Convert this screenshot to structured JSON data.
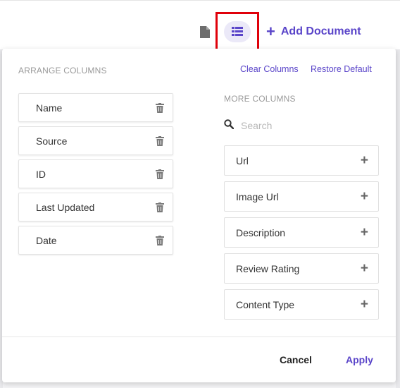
{
  "toolbar": {
    "add_document_label": "Add Document",
    "document_icon": "document-icon",
    "list_view_icon": "list-view-icon",
    "accent_color": "#5a45c9",
    "highlight_color": "#e0000a"
  },
  "arrange": {
    "title": "ARRANGE COLUMNS",
    "clear_label": "Clear Columns",
    "restore_label": "Restore Default",
    "columns": [
      {
        "label": "Name"
      },
      {
        "label": "Source"
      },
      {
        "label": "ID"
      },
      {
        "label": "Last Updated"
      },
      {
        "label": "Date"
      }
    ]
  },
  "more": {
    "title": "MORE COLUMNS",
    "search_placeholder": "Search",
    "columns": [
      {
        "label": "Url"
      },
      {
        "label": "Image Url"
      },
      {
        "label": "Description"
      },
      {
        "label": "Review Rating"
      },
      {
        "label": "Content Type"
      }
    ]
  },
  "footer": {
    "cancel_label": "Cancel",
    "apply_label": "Apply"
  }
}
